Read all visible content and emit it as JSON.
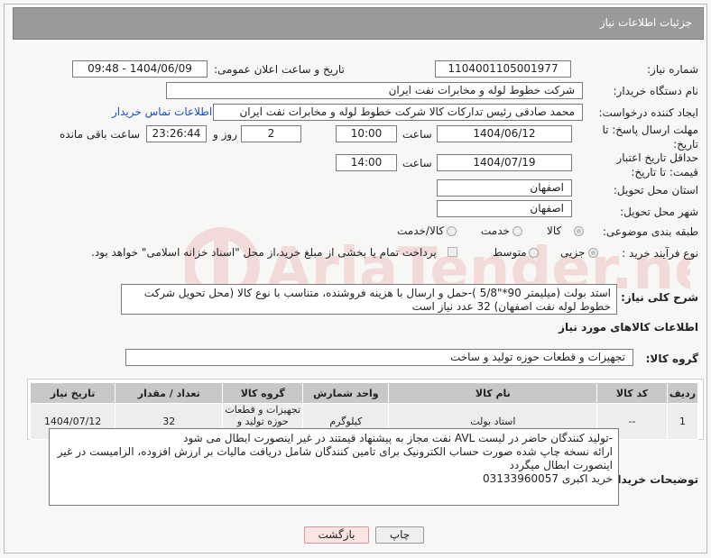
{
  "header": {
    "title": "جزئیات اطلاعات نیاز"
  },
  "fields": {
    "need_number": {
      "label": "شماره نیاز:",
      "value": "1104001105001977"
    },
    "announce_dt": {
      "label": "تاریخ و ساعت اعلان عمومی:",
      "value": "1404/06/09 - 09:48"
    },
    "buyer_org": {
      "label": "نام دستگاه خریدار:",
      "value": "شرکت خطوط لوله و مخابرات نفت ایران"
    },
    "creator": {
      "label": "ایجاد کننده درخواست:",
      "value": "محمد صادقی رئیس تدارکات کالا  شرکت خطوط لوله و مخابرات نفت ایران",
      "contact_link": "اطلاعات تماس خریدار"
    },
    "send_deadline": {
      "label": "مهلت ارسال پاسخ: تا تاریخ:",
      "date": "1404/06/12",
      "time_label": "ساعت",
      "time": "10:00",
      "days": "2",
      "days_label": "روز و",
      "remaining": "23:26:44",
      "remaining_label": "ساعت باقی مانده"
    },
    "price_validity": {
      "label": "حداقل تاریخ اعتبار قیمت: تا تاریخ:",
      "date": "1404/07/19",
      "time_label": "ساعت",
      "time": "14:00"
    },
    "province": {
      "label": "استان محل تحویل:",
      "value": "اصفهان"
    },
    "city": {
      "label": "شهر محل تحویل:",
      "value": "اصفهان"
    },
    "category": {
      "label": "طبقه بندی موضوعی:",
      "options": [
        "کالا",
        "خدمت",
        "کالا/خدمت"
      ]
    },
    "process": {
      "label": "نوع فرآیند خرید :",
      "options": [
        "جزیی",
        "متوسط"
      ],
      "note": "پرداخت تمام یا بخشی از مبلغ خرید،از محل \"اسناد خزانه اسلامی\" خواهد بود."
    }
  },
  "description": {
    "label": "شرح کلی نیاز:",
    "text": "استد بولت (میلیمتر 90*\"5/8 )-حمل و ارسال  با هزینه فروشنده، متناسب با نوع کالا (محل تحویل شرکت خطوط لوله نفت اصفهان) 32  عدد نیاز است"
  },
  "goods_section": {
    "title": "اطلاعات کالاهای مورد نیاز",
    "group_label": "گروه کالا:",
    "group_value": "تجهیزات و قطعات حوزه تولید و ساخت"
  },
  "table": {
    "headers": [
      "ردیف",
      "کد کالا",
      "نام کالا",
      "واحد شمارش",
      "گروه کالا",
      "تعداد / مقدار",
      "تاریخ نیاز"
    ],
    "rows": [
      {
        "row": "1",
        "code": "--",
        "name": "استاد بولت",
        "unit": "کیلوگرم",
        "group": "تجهیزات و قطعات حوزه تولید و ساخت",
        "qty": "32",
        "date": "1404/07/12"
      }
    ]
  },
  "buyer_notes": {
    "label": "توضیحات خریدار:",
    "lines": [
      "-تولید کنندگان  حاضر در لیست  AVL نفت مجاز به پیشنهاد قیمتند در غیر اینصورت ابطال می شود",
      "ارائه نسخه چاپ شده صورت حساب الکترونیک برای تامین کنندگان شامل دریافت مالیات بر ارزش افزوده، الزامیست در غیر اینصورت ابطال میگردد",
      "خرید اکبری 03133960057"
    ]
  },
  "buttons": {
    "print": "چاپ",
    "back": "بازگشت"
  },
  "colors": {
    "header_bg": "#9a9a9a",
    "link": "#1d4fbf",
    "back_button_bg": "#fbe4e4"
  }
}
